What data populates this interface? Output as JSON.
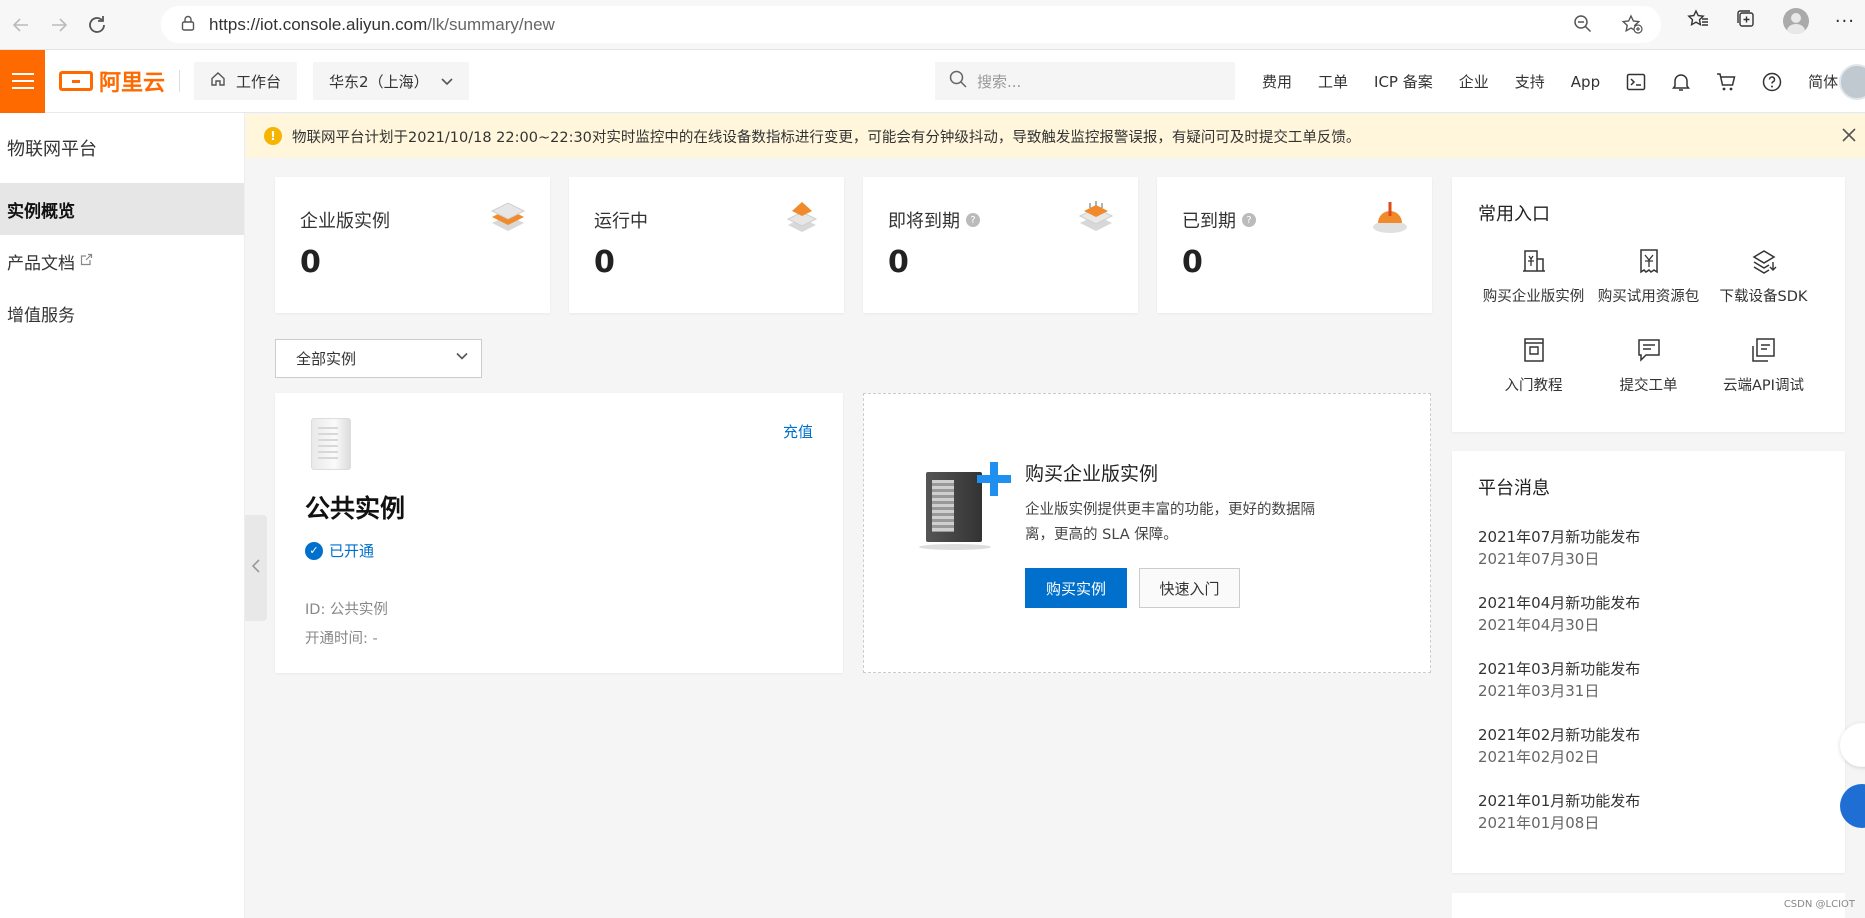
{
  "browser": {
    "url_host": "https://iot.console.aliyun.com",
    "url_path": "/lk/summary/new"
  },
  "header": {
    "logo_text": "阿里云",
    "workbench": "工作台",
    "region": "华东2（上海）",
    "search_placeholder": "搜索...",
    "links": [
      "费用",
      "工单",
      "ICP 备案",
      "企业",
      "支持",
      "App"
    ],
    "lang": "简体"
  },
  "sidebar": {
    "title": "物联网平台",
    "items": [
      {
        "label": "实例概览"
      },
      {
        "label": "产品文档"
      },
      {
        "label": "增值服务"
      }
    ]
  },
  "notice": {
    "text": "物联网平台计划于2021/10/18 22:00~22:30对实时监控中的在线设备数指标进行变更，可能会有分钟级抖动，导致触发监控报警误报，有疑问可及时提交工单反馈。"
  },
  "stats": [
    {
      "label": "企业版实例",
      "value": "0",
      "icon": "stack-layers-icon"
    },
    {
      "label": "运行中",
      "value": "0",
      "icon": "running-layers-icon"
    },
    {
      "label": "即将到期",
      "value": "0",
      "icon": "expiring-calendar-icon"
    },
    {
      "label": "已到期",
      "value": "0",
      "icon": "expired-alert-icon"
    }
  ],
  "filter": {
    "value": "全部实例"
  },
  "instance": {
    "recharge": "充值",
    "title": "公共实例",
    "status": "已开通",
    "id_line": "ID:  公共实例",
    "open_time": "开通时间:  -"
  },
  "buy": {
    "title": "购买企业版实例",
    "desc": "企业版实例提供更丰富的功能，更好的数据隔离，更高的 SLA 保障。",
    "primary_btn": "购买实例",
    "secondary_btn": "快速入门"
  },
  "quick": {
    "title": "常用入口",
    "items": [
      {
        "label": "购买企业版实例",
        "icon": "buy-building-icon"
      },
      {
        "label": "购买试用资源包",
        "icon": "yuan-document-icon"
      },
      {
        "label": "下载设备SDK",
        "icon": "layers-download-icon"
      },
      {
        "label": "入门教程",
        "icon": "tutorial-icon"
      },
      {
        "label": "提交工单",
        "icon": "ticket-icon"
      },
      {
        "label": "云端API调试",
        "icon": "api-debug-icon"
      }
    ]
  },
  "news": {
    "title": "平台消息",
    "items": [
      {
        "title": "2021年07月新功能发布",
        "date": "2021年07月30日"
      },
      {
        "title": "2021年04月新功能发布",
        "date": "2021年04月30日"
      },
      {
        "title": "2021年03月新功能发布",
        "date": "2021年03月31日"
      },
      {
        "title": "2021年02月新功能发布",
        "date": "2021年02月02日"
      },
      {
        "title": "2021年01月新功能发布",
        "date": "2021年01月08日"
      }
    ]
  },
  "watermark": "CSDN @LCIOT",
  "colors": {
    "brand": "#ff6a00",
    "primary": "#0070cc",
    "notice_bg": "#fff6dc"
  }
}
